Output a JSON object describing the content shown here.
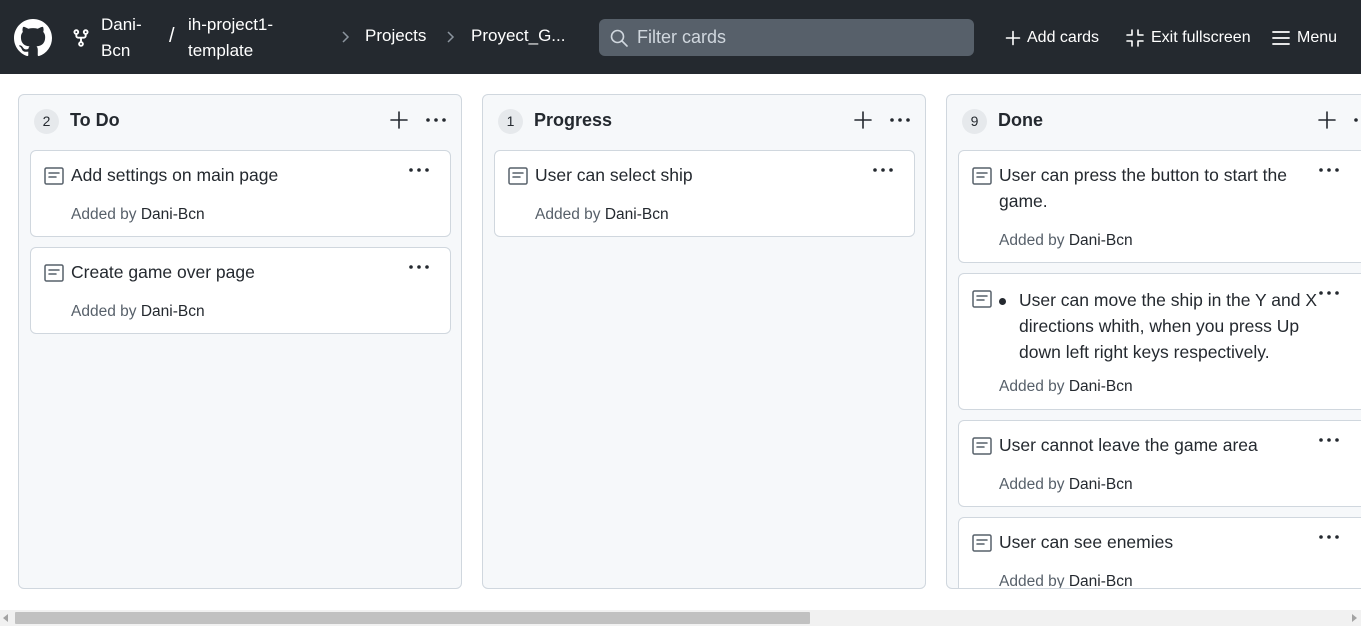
{
  "header": {
    "owner": "Dani-Bcn",
    "slash": "/",
    "repo": "ih-project1-template",
    "crumb_projects": "Projects",
    "crumb_project": "Proyect_G...",
    "search_placeholder": "Filter cards",
    "add_cards_label": "Add cards",
    "exit_fullscreen_label": "Exit fullscreen",
    "menu_label": "Menu"
  },
  "columns": [
    {
      "count": "2",
      "title": "To Do",
      "cards": [
        {
          "title": "Add settings on main page",
          "added_by_label": "Added by",
          "author": "Dani-Bcn"
        },
        {
          "title": "Create game over page",
          "added_by_label": "Added by",
          "author": "Dani-Bcn"
        }
      ]
    },
    {
      "count": "1",
      "title": "Progress",
      "cards": [
        {
          "title": "User can select ship",
          "added_by_label": "Added by",
          "author": "Dani-Bcn"
        }
      ]
    },
    {
      "count": "9",
      "title": "Done",
      "cards": [
        {
          "title": "User can press the button to start the game.",
          "added_by_label": "Added by",
          "author": "Dani-Bcn"
        },
        {
          "title": "User can move the ship in the Y and X directions whith, when you press Up down left right keys respectively.",
          "added_by_label": "Added by",
          "author": "Dani-Bcn"
        },
        {
          "title": "User cannot leave the game area",
          "added_by_label": "Added by",
          "author": "Dani-Bcn"
        },
        {
          "title": "User can see enemies",
          "added_by_label": "Added by",
          "author": "Dani-Bcn"
        }
      ]
    }
  ],
  "icons": {
    "logo": "github-logo-icon",
    "fork": "repo-fork-icon",
    "chevron": "chevron-right-icon",
    "search": "search-icon",
    "plus": "plus-icon",
    "collapse": "screen-normal-icon",
    "menu": "hamburger-icon",
    "note": "note-icon",
    "more": "kebab-horizontal-icon"
  },
  "colors": {
    "header_bg": "#24292f",
    "column_bg": "#f6f8fa",
    "border": "#d0d7de",
    "muted_text": "#57606a"
  }
}
